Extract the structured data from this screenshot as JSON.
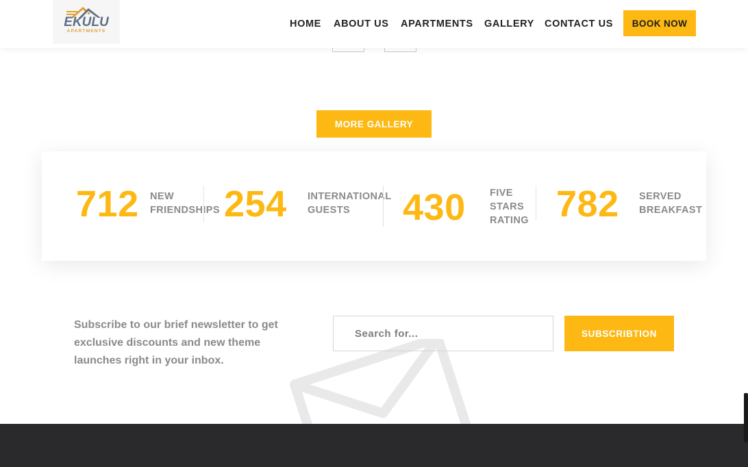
{
  "header": {
    "logo": {
      "name": "EKULU",
      "sub": "APARTMENTS"
    },
    "nav": [
      "HOME",
      "ABOUT US",
      "APARTMENTS",
      "GALLERY",
      "CONTACT US"
    ],
    "book_label": "BOOK NOW"
  },
  "gallery": {
    "more_label": "MORE GALLERY"
  },
  "stats": [
    {
      "number": "712",
      "label_lines": [
        "NEW",
        "FRIENDSHIPS"
      ]
    },
    {
      "number": "254",
      "label_lines": [
        "INTERNATIONAL",
        "GUESTS"
      ]
    },
    {
      "number": "430",
      "label_lines": [
        "FIVE",
        "STARS",
        "RATING"
      ]
    },
    {
      "number": "782",
      "label_lines": [
        "SERVED",
        "BREAKFAST"
      ]
    }
  ],
  "newsletter": {
    "text": "Subscribe to our brief newsletter to get exclusive discounts and new theme launches right in your inbox.",
    "placeholder": "Search for...",
    "button_label": "SUBSCRIBTION"
  },
  "colors": {
    "accent": "#fdb813",
    "footer": "#2a2a2c",
    "text": "#8a8a8a",
    "nav": "#222222"
  },
  "icons": [
    "logo-house-icon",
    "envelope-watermark-icon"
  ]
}
